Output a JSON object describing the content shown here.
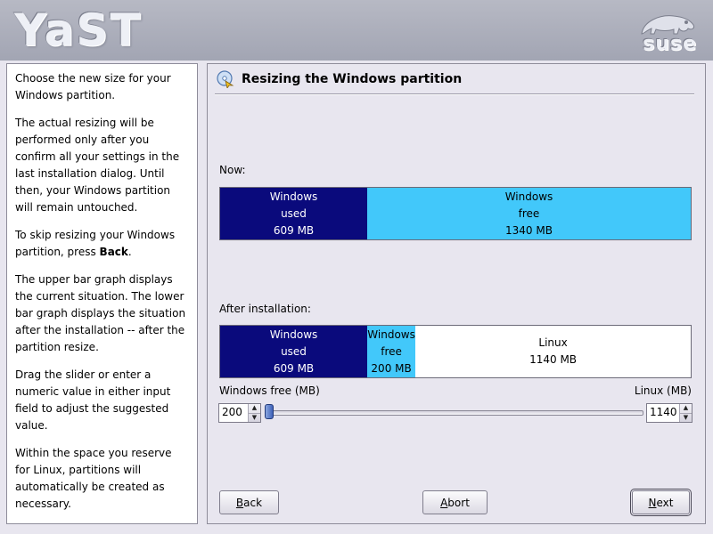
{
  "header": {
    "app_logo": "YaST",
    "brand_logo": "suse"
  },
  "help": {
    "p1": "Choose the new size for your Windows partition.",
    "p2": "The actual resizing will be performed only after you confirm all your settings in the last installation dialog. Until then, your Windows partition will remain untouched.",
    "p3_before": "To skip resizing your Windows partition, press ",
    "p3_bold": "Back",
    "p3_after": ".",
    "p4": "The upper bar graph displays the current situation. The lower bar graph displays the situation after the installation -- after the partition resize.",
    "p5": "Drag the slider or enter a numeric value in either input field to adjust the suggested value.",
    "p6": "Within the space you reserve for Linux, partitions will automatically be created as necessary."
  },
  "main": {
    "title": "Resizing the Windows partition",
    "title_icon": "disk-cd-icon",
    "now_label": "Now:",
    "now_bar": {
      "used": {
        "line1": "Windows",
        "line2": "used",
        "line3": "609 MB",
        "mb": 609
      },
      "free": {
        "line1": "Windows",
        "line2": "free",
        "line3": "1340 MB",
        "mb": 1340
      }
    },
    "after_label": "After installation:",
    "after_bar": {
      "used": {
        "line1": "Windows",
        "line2": "used",
        "line3": "609 MB",
        "mb": 609
      },
      "free": {
        "line1": "Windows",
        "line2": "free",
        "line3": "200 MB",
        "mb": 200
      },
      "linux": {
        "line1": "Linux",
        "line2": "1140 MB",
        "mb": 1140
      }
    },
    "windows_free_label": "Windows free (MB)",
    "linux_label": "Linux (MB)",
    "windows_free_value": "200",
    "linux_value": "1140",
    "slider_fraction": 0.149
  },
  "buttons": {
    "back": {
      "mnemonic": "B",
      "rest": "ack"
    },
    "abort": {
      "mnemonic": "A",
      "rest": "bort"
    },
    "next": {
      "mnemonic": "N",
      "rest": "ext"
    }
  },
  "colors": {
    "used": "#0a0a7c",
    "free": "#42c8fa",
    "linux": "#ffffff"
  }
}
